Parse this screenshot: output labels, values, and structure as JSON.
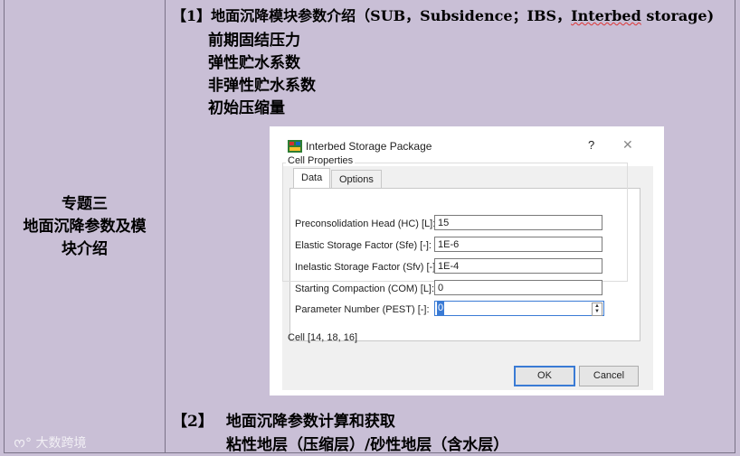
{
  "left": {
    "topic_lines": [
      "专题三",
      "地面沉降参数及模",
      "块介绍"
    ]
  },
  "right": {
    "head1_prefix": "【1】地面沉降模块参数介绍（SUB，Subsidence；IBS，",
    "head1_underlined": "Interbed",
    "head1_suffix": " storage)",
    "params": [
      "前期固结压力",
      "弹性贮水系数",
      "非弹性贮水系数",
      "初始压缩量"
    ],
    "head2_num": "【2】",
    "head2_text": "地面沉降参数计算和获取",
    "sub2": "粘性地层（压缩层）/砂性地层（含水层）"
  },
  "dialog": {
    "title": "Interbed Storage Package",
    "help": "?",
    "close": "✕",
    "tabs": [
      "Data",
      "Options"
    ],
    "group": "Cell Properties",
    "fields": [
      {
        "label": "Preconsolidation Head (HC) [L]:",
        "value": "15"
      },
      {
        "label": "Elastic Storage Factor (Sfe) [-]:",
        "value": "1E-6"
      },
      {
        "label": "Inelastic Storage Factor (Sfv) [-]:",
        "value": "1E-4"
      },
      {
        "label": "Starting Compaction (COM) [L]:",
        "value": "0"
      }
    ],
    "spinner": {
      "label": "Parameter Number (PEST) [-]:",
      "value": "0"
    },
    "cell": "Cell [14, 18, 16]",
    "ok": "OK",
    "cancel": "Cancel"
  },
  "watermark": "大数跨境"
}
